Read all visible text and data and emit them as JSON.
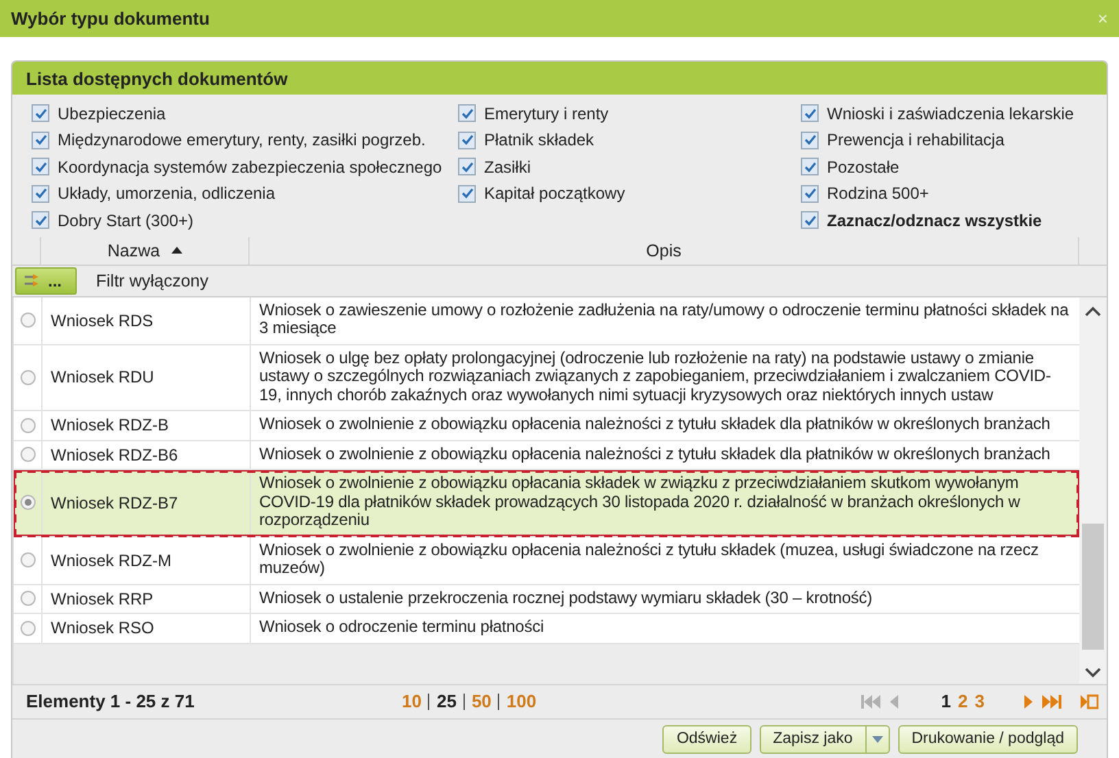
{
  "window": {
    "title": "Wybór typu dokumentu",
    "close": "×"
  },
  "panel": {
    "title": "Lista dostępnych dokumentów"
  },
  "category_columns": [
    [
      {
        "label": "Ubezpieczenia",
        "checked": true,
        "kind": "category"
      },
      {
        "label": "Międzynarodowe emerytury, renty, zasiłki pogrzeb.",
        "checked": true,
        "kind": "category"
      },
      {
        "label": "Koordynacja systemów zabezpieczenia społecznego",
        "checked": true,
        "kind": "category"
      },
      {
        "label": "Układy, umorzenia, odliczenia",
        "checked": true,
        "kind": "category"
      },
      {
        "label": "Dobry Start (300+)",
        "checked": true,
        "kind": "category"
      }
    ],
    [
      {
        "label": "Emerytury i renty",
        "checked": true,
        "kind": "category"
      },
      {
        "label": "Płatnik składek",
        "checked": true,
        "kind": "category"
      },
      {
        "label": "Zasiłki",
        "checked": true,
        "kind": "category"
      },
      {
        "label": "Kapitał początkowy",
        "checked": true,
        "kind": "category"
      }
    ],
    [
      {
        "label": "Wnioski i zaświadczenia lekarskie",
        "checked": true,
        "kind": "category"
      },
      {
        "label": "Prewencja i rehabilitacja",
        "checked": true,
        "kind": "category"
      },
      {
        "label": "Pozostałe",
        "checked": true,
        "kind": "category"
      },
      {
        "label": "Rodzina 500+",
        "checked": true,
        "kind": "category"
      },
      {
        "label": "Zaznacz/odznacz wszystkie",
        "checked": true,
        "kind": "toggle_all"
      }
    ]
  ],
  "table": {
    "columns": [
      {
        "label": "Nazwa",
        "sorted": true
      },
      {
        "label": "Opis",
        "sorted": false
      }
    ],
    "filter": {
      "button": "...",
      "status": "Filtr wyłączony"
    },
    "rows": [
      {
        "name": "Wniosek RDS",
        "description": "Wniosek o zawieszenie umowy o rozłożenie zadłużenia na raty/umowy o odroczenie terminu płatności składek na 3 miesiące",
        "selected": false
      },
      {
        "name": "Wniosek RDU",
        "description": "Wniosek o ulgę bez opłaty prolongacyjnej (odroczenie lub rozłożenie na raty) na podstawie ustawy o zmianie ustawy o szczególnych rozwiązaniach związanych z zapobieganiem, przeciwdziałaniem i zwalczaniem COVID-19, innych chorób zakaźnych oraz wywołanych nimi sytuacji kryzysowych oraz niektórych innych ustaw",
        "selected": false
      },
      {
        "name": "Wniosek RDZ-B",
        "description": "Wniosek o zwolnienie z obowiązku opłacenia należności z tytułu składek dla płatników w określonych branżach",
        "selected": false
      },
      {
        "name": "Wniosek RDZ-B6",
        "description": "Wniosek o zwolnienie z obowiązku opłacenia należności z tytułu składek dla płatników w określonych branżach",
        "selected": false
      },
      {
        "name": "Wniosek RDZ-B7",
        "description": "Wniosek o zwolnienie z obowiązku opłacania składek w związku z przeciwdziałaniem skutkom wywołanym COVID-19 dla płatników składek prowadzących 30 listopada 2020 r. działalność w branżach określonych w rozporządzeniu",
        "selected": true
      },
      {
        "name": "Wniosek RDZ-M",
        "description": "Wniosek o zwolnienie z obowiązku opłacenia należności z tytułu składek (muzea, usługi świadczone na rzecz muzeów)",
        "selected": false
      },
      {
        "name": "Wniosek RRP",
        "description": "Wniosek o ustalenie przekroczenia rocznej podstawy wymiaru składek (30 – krotność)",
        "selected": false
      },
      {
        "name": "Wniosek RSO",
        "description": "Wniosek o odroczenie terminu płatności",
        "selected": false
      }
    ]
  },
  "pager": {
    "summary": "Elementy 1 - 25 z 71",
    "page_sizes": [
      {
        "label": "10",
        "selected": false
      },
      {
        "label": "25",
        "selected": true
      },
      {
        "label": "50",
        "selected": false
      },
      {
        "label": "100",
        "selected": false
      }
    ],
    "pages": [
      {
        "label": "1",
        "selected": true
      },
      {
        "label": "2",
        "selected": false
      },
      {
        "label": "3",
        "selected": false
      }
    ]
  },
  "buttons": [
    {
      "label": "Odśwież",
      "kind": "plain"
    },
    {
      "label": "Zapisz jako",
      "kind": "split"
    },
    {
      "label": "Drukowanie / podgląd",
      "kind": "plain"
    }
  ]
}
